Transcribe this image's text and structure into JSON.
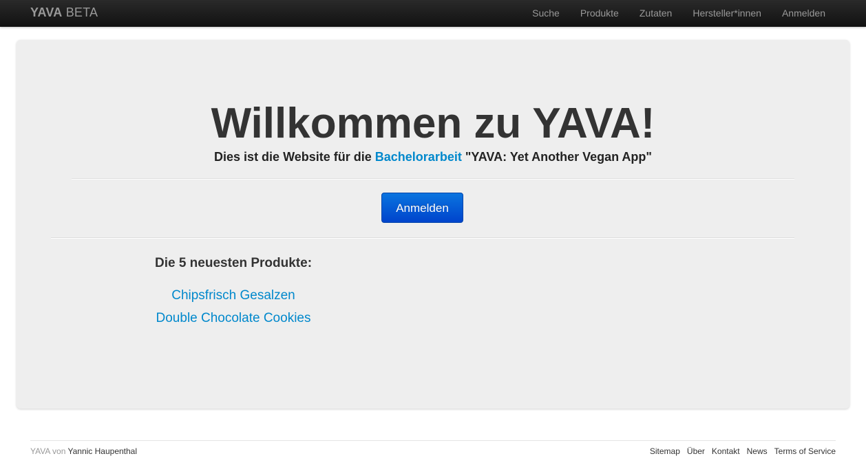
{
  "navbar": {
    "brand_bold": "YAVA",
    "brand_light": "BETA",
    "items": [
      {
        "label": "Suche"
      },
      {
        "label": "Produkte"
      },
      {
        "label": "Zutaten"
      },
      {
        "label": "Hersteller*innen"
      },
      {
        "label": "Anmelden"
      }
    ]
  },
  "hero": {
    "title": "Willkommen zu YAVA!",
    "subtitle_before": "Dies ist die Website für die",
    "subtitle_link": "Bachelorarbeit",
    "subtitle_after": "\"YAVA: Yet Another Vegan App\"",
    "login_button": "Anmelden"
  },
  "products": {
    "heading": "Die 5 neuesten Produkte:",
    "items": [
      {
        "name": "Chipsfrisch Gesalzen"
      },
      {
        "name": "Double Chocolate Cookies"
      }
    ]
  },
  "footer": {
    "prefix": "YAVA von",
    "author": "Yannic Haupenthal",
    "links": [
      {
        "label": "Sitemap"
      },
      {
        "label": "Über"
      },
      {
        "label": "Kontakt"
      },
      {
        "label": "News"
      },
      {
        "label": "Terms of Service"
      }
    ]
  },
  "colors": {
    "navbar": "#1b1b1b",
    "link": "#0088cc",
    "button": "#0055cc",
    "hero_bg": "#eeeeee"
  }
}
